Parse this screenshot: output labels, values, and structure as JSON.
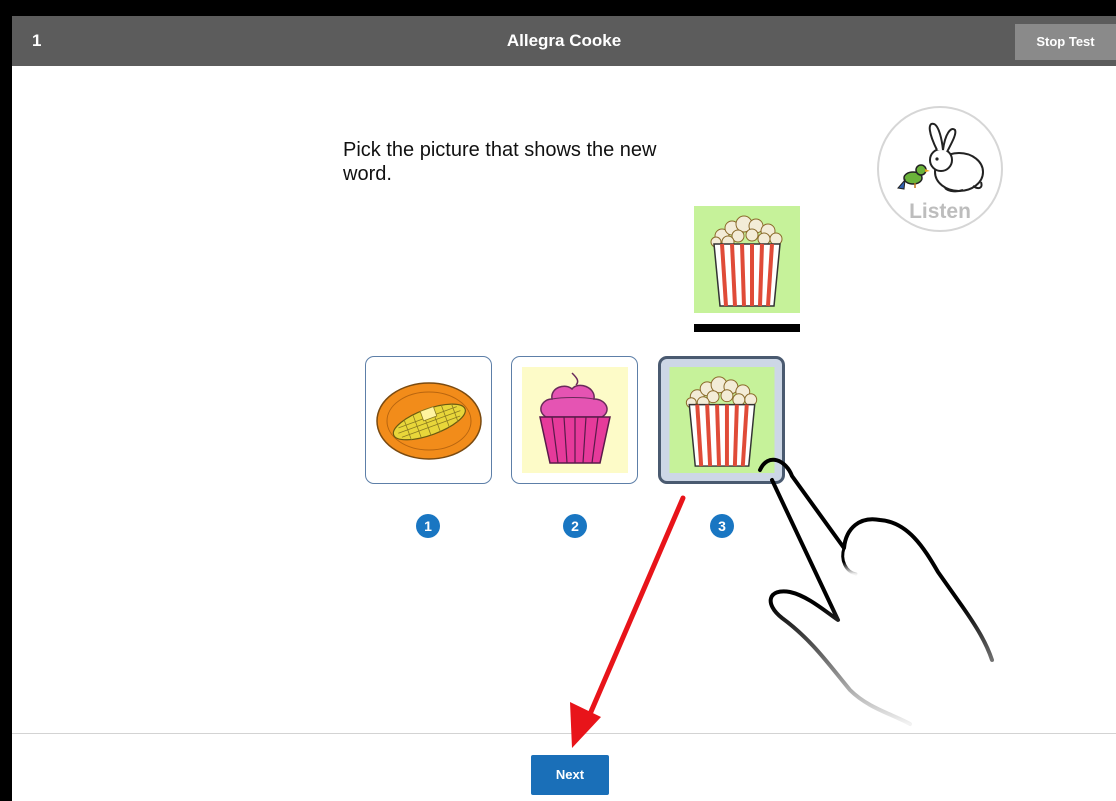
{
  "header": {
    "question_number": "1",
    "student_name": "Allegra Cooke",
    "stop_label": "Stop Test"
  },
  "prompt": {
    "text": "Pick the picture that shows the new word."
  },
  "listen": {
    "label": "Listen",
    "icon": "listen-animals-icon"
  },
  "target": {
    "icon": "popcorn-icon"
  },
  "choices": [
    {
      "number": "1",
      "icon": "corn-on-plate-icon",
      "selected": false
    },
    {
      "number": "2",
      "icon": "cupcake-icon",
      "selected": false
    },
    {
      "number": "3",
      "icon": "popcorn-icon",
      "selected": true
    }
  ],
  "footer": {
    "next_label": "Next"
  },
  "colors": {
    "header": "#5c5c5c",
    "accent": "#1a6fb8",
    "annotation_arrow": "#e8141a"
  }
}
